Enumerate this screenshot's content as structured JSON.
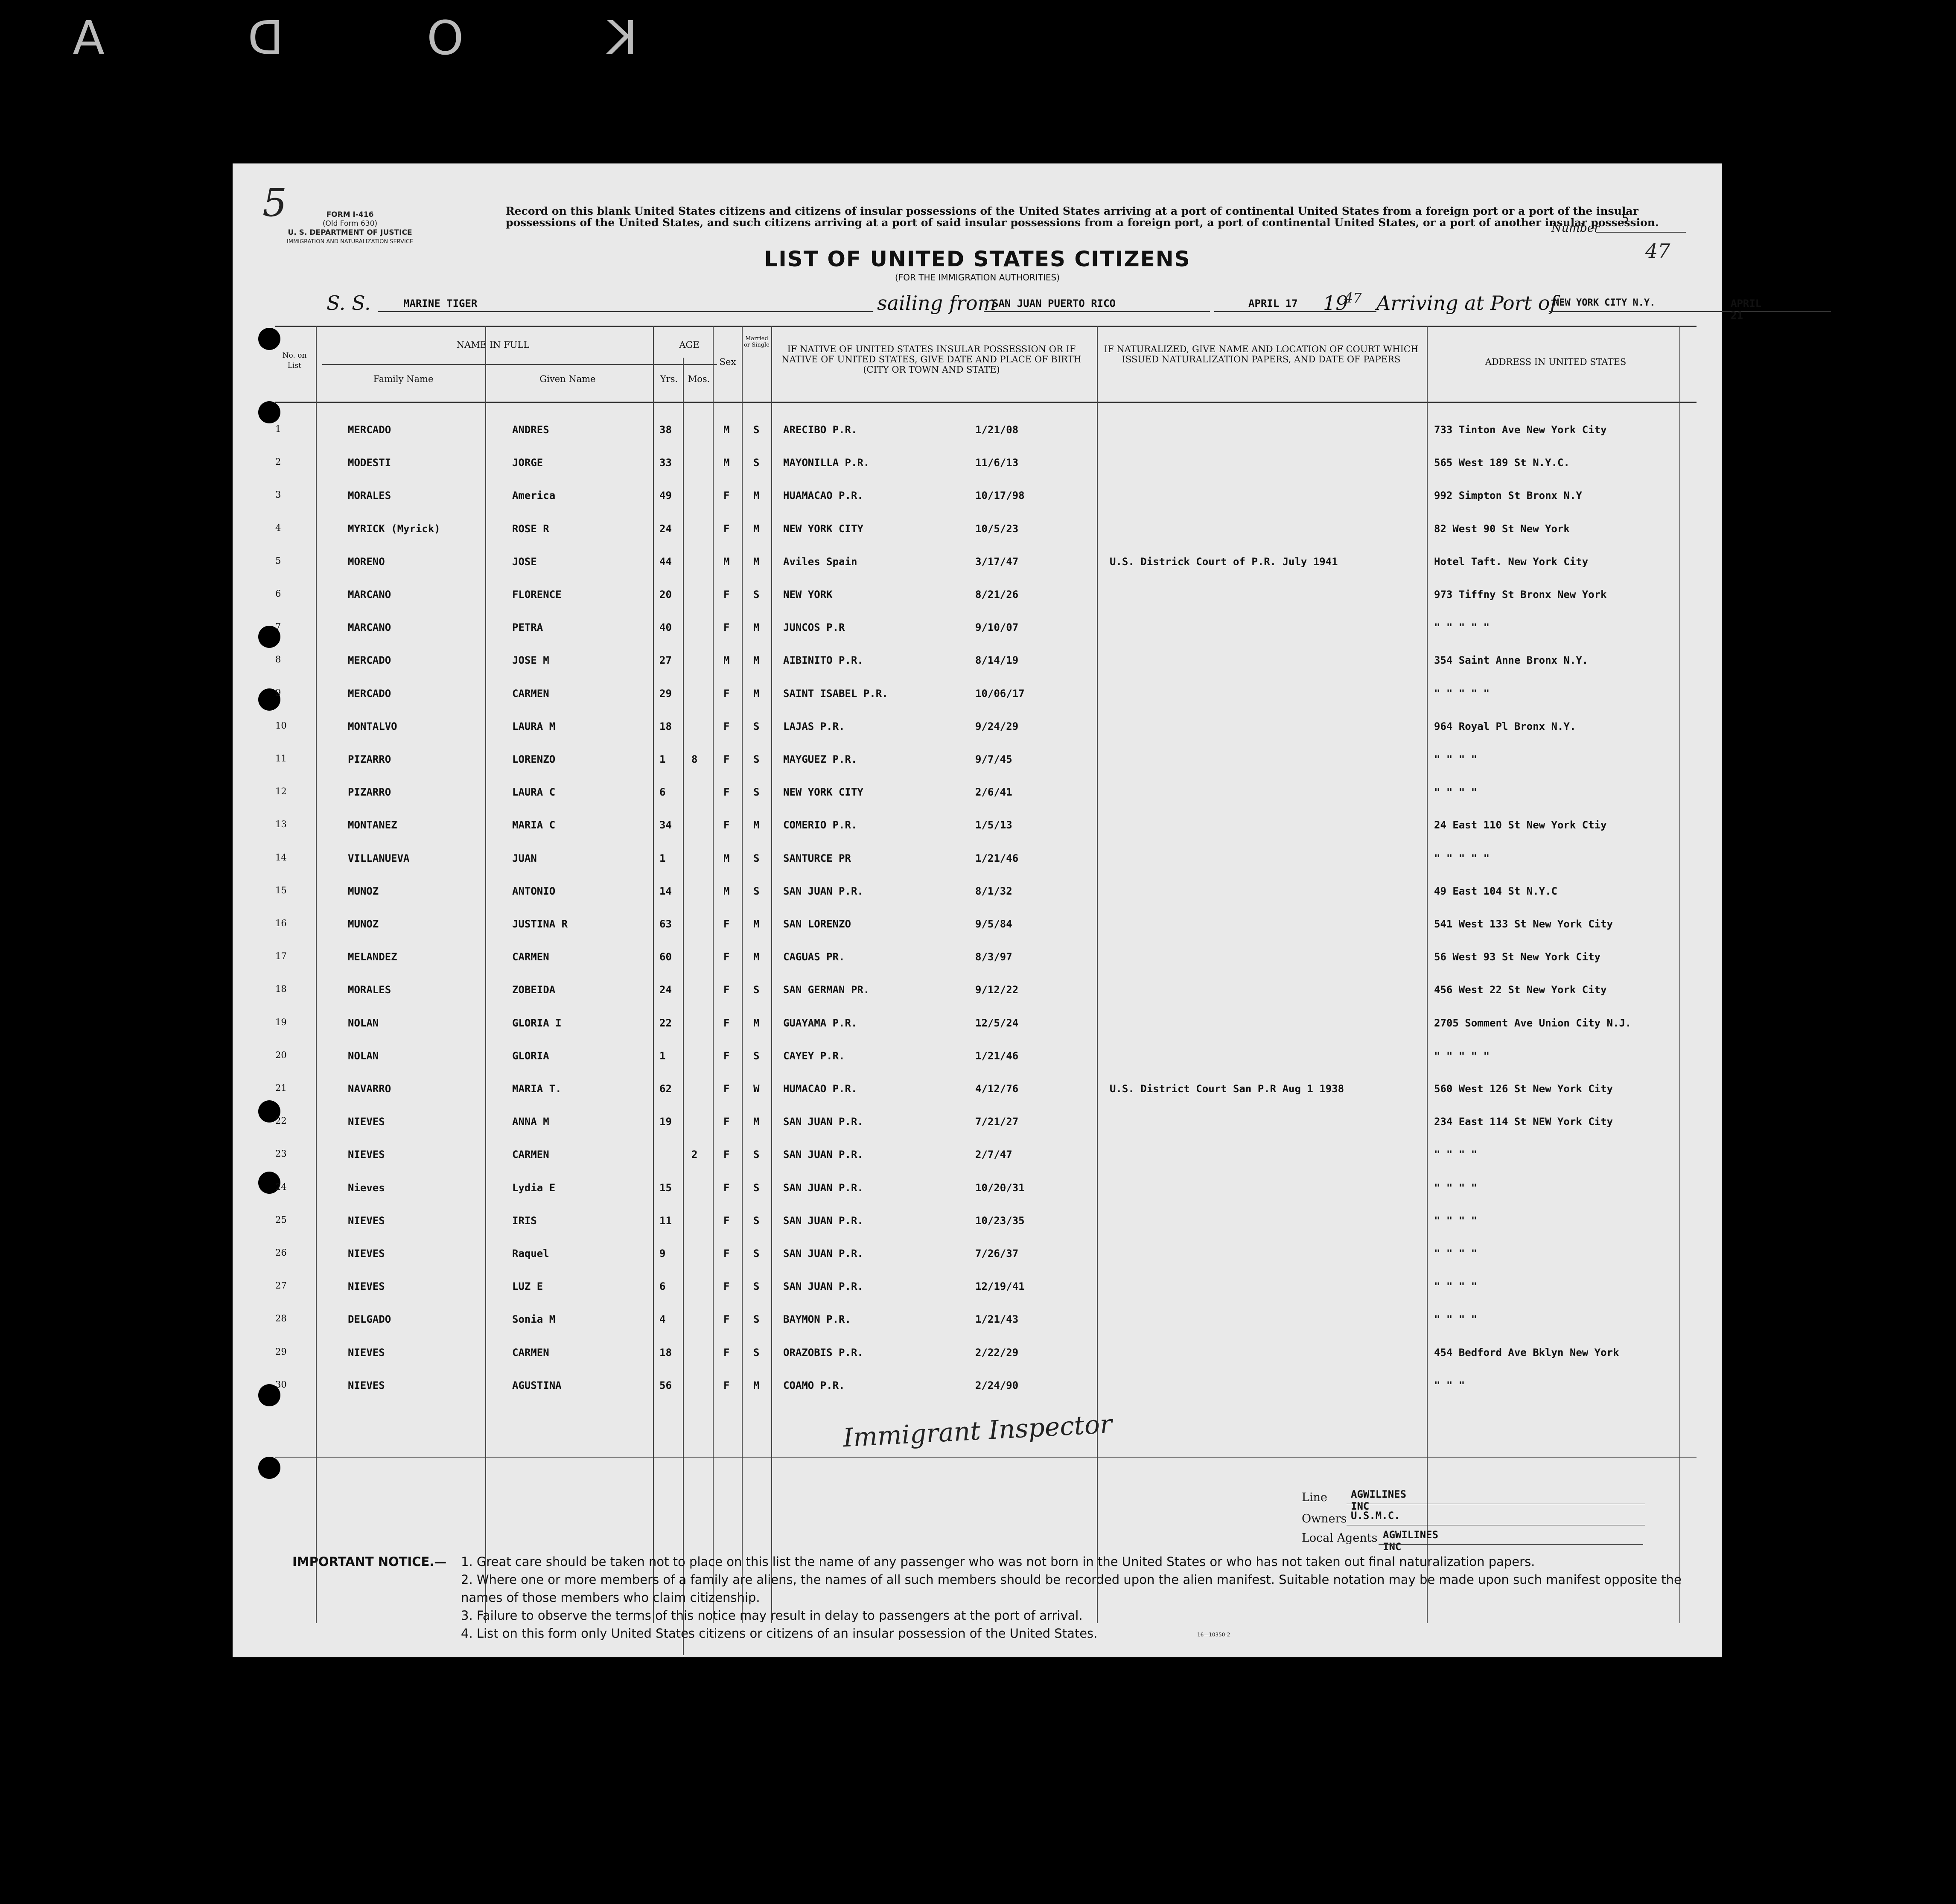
{
  "film_edge": "K O D A",
  "form": {
    "form_id_lines": [
      "FORM I-416",
      "(Old Form 630)",
      "U. S. DEPARTMENT OF JUSTICE",
      "IMMIGRATION AND NATURALIZATION SERVICE"
    ],
    "page_mark": "5",
    "record_text": "Record on this blank United States citizens and citizens of insular possessions of the United States arriving at a port of continental United States from a foreign port or a port of the insular possessions of the United States, and such citizens arriving at a port of said insular possessions from a foreign port, a port of continental United States, or a port of another insular possession.",
    "title": "LIST OF UNITED STATES CITIZENS",
    "subtitle": "(FOR THE IMMIGRATION AUTHORITIES)",
    "number_label": "Number",
    "number_value": "5",
    "year_mark": "47"
  },
  "voyage": {
    "ss_label": "S. S.",
    "ship": "MARINE TIGER",
    "sailing_label": "sailing from",
    "from": "SAN JUAN PUERTO RICO",
    "depart_date": "APRIL 17",
    "depart_year_prefix": "19",
    "depart_year_suffix": "47",
    "arriving_label": "Arriving at Port of",
    "port": "NEW YORK CITY N.Y.",
    "arrive_date": "APRIL 21",
    "arrive_year_prefix": "19",
    "arrive_year_suffix": "47"
  },
  "columns": {
    "no": "No. on List",
    "name_in_full": "NAME IN FULL",
    "family_name": "Family Name",
    "given_name": "Given Name",
    "age": "AGE",
    "yrs": "Yrs.",
    "mos": "Mos.",
    "sex": "Sex",
    "married": "Married or Single",
    "birth": "IF NATIVE OF UNITED STATES INSULAR POSSESSION OR IF NATIVE OF UNITED STATES, GIVE DATE AND PLACE OF BIRTH (CITY OR TOWN AND STATE)",
    "naturalized": "IF NATURALIZED, GIVE NAME AND LOCATION OF COURT WHICH ISSUED NATURALIZATION PAPERS, AND DATE OF PAPERS",
    "address": "ADDRESS IN UNITED STATES"
  },
  "rows": [
    {
      "no": "1",
      "family": "MERCADO",
      "given": "ANDRES",
      "yrs": "38",
      "mos": "",
      "sex": "M",
      "ms": "S",
      "place": "ARECIBO P.R.",
      "date": "1/21/08",
      "nat": "",
      "addr": "733 Tinton Ave New York City"
    },
    {
      "no": "2",
      "family": "MODESTI",
      "given": "JORGE",
      "yrs": "33",
      "mos": "",
      "sex": "M",
      "ms": "S",
      "place": "MAYONILLA P.R.",
      "date": "11/6/13",
      "nat": "",
      "addr": "565 West 189 St N.Y.C."
    },
    {
      "no": "3",
      "family": "MORALES",
      "given": "America",
      "yrs": "49",
      "mos": "",
      "sex": "F",
      "ms": "M",
      "place": "HUAMACAO P.R.",
      "date": "10/17/98",
      "nat": "",
      "addr": "992 Simpton St Bronx N.Y"
    },
    {
      "no": "4",
      "family": "MYRICK (Myrick)",
      "given": "ROSE R",
      "yrs": "24",
      "mos": "",
      "sex": "F",
      "ms": "M",
      "place": "NEW YORK CITY",
      "date": "10/5/23",
      "nat": "",
      "addr": "82 West 90 St New York"
    },
    {
      "no": "5",
      "family": "MORENO",
      "given": "JOSE",
      "yrs": "44",
      "mos": "",
      "sex": "M",
      "ms": "M",
      "place": "Aviles Spain",
      "date": "3/17/47",
      "nat": "U.S. Districk Court of P.R. July 1941",
      "addr": "Hotel Taft. New York City"
    },
    {
      "no": "6",
      "family": "MARCANO",
      "given": "FLORENCE",
      "yrs": "20",
      "mos": "",
      "sex": "F",
      "ms": "S",
      "place": "NEW YORK",
      "date": "8/21/26",
      "nat": "",
      "addr": "973 Tiffny St Bronx New York"
    },
    {
      "no": "7",
      "family": "MARCANO",
      "given": "PETRA",
      "yrs": "40",
      "mos": "",
      "sex": "F",
      "ms": "M",
      "place": "JUNCOS P.R",
      "date": "9/10/07",
      "nat": "",
      "addr": "\"  \"  \"  \"  \""
    },
    {
      "no": "8",
      "family": "MERCADO",
      "given": "JOSE M",
      "yrs": "27",
      "mos": "",
      "sex": "M",
      "ms": "M",
      "place": "AIBINITO P.R.",
      "date": "8/14/19",
      "nat": "",
      "addr": "354 Saint Anne Bronx N.Y."
    },
    {
      "no": "9",
      "family": "MERCADO",
      "given": "CARMEN",
      "yrs": "29",
      "mos": "",
      "sex": "F",
      "ms": "M",
      "place": "SAINT ISABEL P.R.",
      "date": "10/06/17",
      "nat": "",
      "addr": "\"  \"  \"  \"  \""
    },
    {
      "no": "10",
      "family": "MONTALVO",
      "given": "LAURA M",
      "yrs": "18",
      "mos": "",
      "sex": "F",
      "ms": "S",
      "place": "LAJAS P.R.",
      "date": "9/24/29",
      "nat": "",
      "addr": "964 Royal Pl Bronx N.Y."
    },
    {
      "no": "11",
      "family": "PIZARRO",
      "given": "LORENZO",
      "yrs": "1",
      "mos": "8",
      "sex": "F",
      "ms": "S",
      "place": "MAYGUEZ P.R.",
      "date": "9/7/45",
      "nat": "",
      "addr": "\"  \"  \"  \""
    },
    {
      "no": "12",
      "family": "PIZARRO",
      "given": "LAURA C",
      "yrs": "6",
      "mos": "",
      "sex": "F",
      "ms": "S",
      "place": "NEW YORK CITY",
      "date": "2/6/41",
      "nat": "",
      "addr": "\"  \"  \"  \""
    },
    {
      "no": "13",
      "family": "MONTANEZ",
      "given": "MARIA C",
      "yrs": "34",
      "mos": "",
      "sex": "F",
      "ms": "M",
      "place": "COMERIO P.R.",
      "date": "1/5/13",
      "nat": "",
      "addr": "24 East 110 St New York Ctiy"
    },
    {
      "no": "14",
      "family": "VILLANUEVA",
      "given": "JUAN",
      "yrs": "1",
      "mos": "",
      "sex": "M",
      "ms": "S",
      "place": "SANTURCE PR",
      "date": "1/21/46",
      "nat": "",
      "addr": "\"  \"  \"  \"  \""
    },
    {
      "no": "15",
      "family": "MUNOZ",
      "given": "ANTONIO",
      "yrs": "14",
      "mos": "",
      "sex": "M",
      "ms": "S",
      "place": "SAN JUAN P.R.",
      "date": "8/1/32",
      "nat": "",
      "addr": "49 East 104 St N.Y.C"
    },
    {
      "no": "16",
      "family": "MUNOZ",
      "given": "JUSTINA R",
      "yrs": "63",
      "mos": "",
      "sex": "F",
      "ms": "M",
      "place": "SAN LORENZO",
      "date": "9/5/84",
      "nat": "",
      "addr": "541 West 133 St New York City"
    },
    {
      "no": "17",
      "family": "MELANDEZ",
      "given": "CARMEN",
      "yrs": "60",
      "mos": "",
      "sex": "F",
      "ms": "M",
      "place": "CAGUAS PR.",
      "date": "8/3/97",
      "nat": "",
      "addr": "56 West 93 St New York City"
    },
    {
      "no": "18",
      "family": "MORALES",
      "given": "ZOBEIDA",
      "yrs": "24",
      "mos": "",
      "sex": "F",
      "ms": "S",
      "place": "SAN GERMAN PR.",
      "date": "9/12/22",
      "nat": "",
      "addr": "456 West 22 St New York City"
    },
    {
      "no": "19",
      "family": "NOLAN",
      "given": "GLORIA I",
      "yrs": "22",
      "mos": "",
      "sex": "F",
      "ms": "M",
      "place": "GUAYAMA P.R.",
      "date": "12/5/24",
      "nat": "",
      "addr": "2705 Somment Ave Union City N.J."
    },
    {
      "no": "20",
      "family": "NOLAN",
      "given": "GLORIA",
      "yrs": "1",
      "mos": "",
      "sex": "F",
      "ms": "S",
      "place": "CAYEY P.R.",
      "date": "1/21/46",
      "nat": "",
      "addr": "\"  \"  \"  \"  \""
    },
    {
      "no": "21",
      "family": "NAVARRO",
      "given": "MARIA T.",
      "yrs": "62",
      "mos": "",
      "sex": "F",
      "ms": "W",
      "place": "HUMACAO P.R.",
      "date": "4/12/76",
      "nat": "U.S. District Court San P.R  Aug 1 1938",
      "addr": "560 West 126 St New York City"
    },
    {
      "no": "22",
      "family": "NIEVES",
      "given": "ANNA M",
      "yrs": "19",
      "mos": "",
      "sex": "F",
      "ms": "M",
      "place": "SAN JUAN P.R.",
      "date": "7/21/27",
      "nat": "",
      "addr": "234 East 114 St NEW York City"
    },
    {
      "no": "23",
      "family": "NIEVES",
      "given": "CARMEN",
      "yrs": "",
      "mos": "2",
      "sex": "F",
      "ms": "S",
      "place": "SAN JUAN P.R.",
      "date": "2/7/47",
      "nat": "",
      "addr": "\"  \"  \"  \""
    },
    {
      "no": "24",
      "family": "Nieves",
      "given": "Lydia E",
      "yrs": "15",
      "mos": "",
      "sex": "F",
      "ms": "S",
      "place": "SAN JUAN P.R.",
      "date": "10/20/31",
      "nat": "",
      "addr": "\"  \"  \"  \""
    },
    {
      "no": "25",
      "family": "NIEVES",
      "given": "IRIS",
      "yrs": "11",
      "mos": "",
      "sex": "F",
      "ms": "S",
      "place": "SAN JUAN P.R.",
      "date": "10/23/35",
      "nat": "",
      "addr": "\"  \"  \"  \""
    },
    {
      "no": "26",
      "family": "NIEVES",
      "given": "Raquel",
      "yrs": "9",
      "mos": "",
      "sex": "F",
      "ms": "S",
      "place": "SAN JUAN P.R.",
      "date": "7/26/37",
      "nat": "",
      "addr": "\"  \"  \"  \""
    },
    {
      "no": "27",
      "family": "NIEVES",
      "given": "LUZ E",
      "yrs": "6",
      "mos": "",
      "sex": "F",
      "ms": "S",
      "place": "SAN JUAN P.R.",
      "date": "12/19/41",
      "nat": "",
      "addr": "\"  \"  \"  \""
    },
    {
      "no": "28",
      "family": "DELGADO",
      "given": "Sonia M",
      "yrs": "4",
      "mos": "",
      "sex": "F",
      "ms": "S",
      "place": "BAYMON P.R.",
      "date": "1/21/43",
      "nat": "",
      "addr": "\"  \"  \"  \""
    },
    {
      "no": "29",
      "family": "NIEVES",
      "given": "CARMEN",
      "yrs": "18",
      "mos": "",
      "sex": "F",
      "ms": "S",
      "place": "ORAZOBIS P.R.",
      "date": "2/22/29",
      "nat": "",
      "addr": "454 Bedford Ave Bklyn New York"
    },
    {
      "no": "30",
      "family": "NIEVES",
      "given": "AGUSTINA",
      "yrs": "56",
      "mos": "",
      "sex": "F",
      "ms": "M",
      "place": "COAMO P.R.",
      "date": "2/24/90",
      "nat": "",
      "addr": "\"  \"  \""
    }
  ],
  "footer": {
    "line_label": "Line",
    "line_value": "AGWILINES INC",
    "owners_label": "Owners",
    "owners_value": "U.S.M.C.",
    "agents_label": "Local Agents",
    "agents_value": "AGWILINES INC",
    "notice_title": "IMPORTANT NOTICE.—",
    "notice_items": [
      "1. Great care should be taken not to place on this list the name of any passenger who was not born in the United States or who has not taken out final naturalization papers.",
      "2. Where one or more members of a family are aliens, the names of all such members should be recorded upon the alien manifest.  Suitable notation may be made upon such manifest opposite the names of those members who claim citizenship.",
      "3. Failure to observe the terms of this notice may result in delay to passengers at the port of arrival.",
      "4. List on this form only United States citizens or citizens of an insular possession of the United States."
    ],
    "form_code": "16—10350-2",
    "signature": "Immigrant Inspector"
  }
}
